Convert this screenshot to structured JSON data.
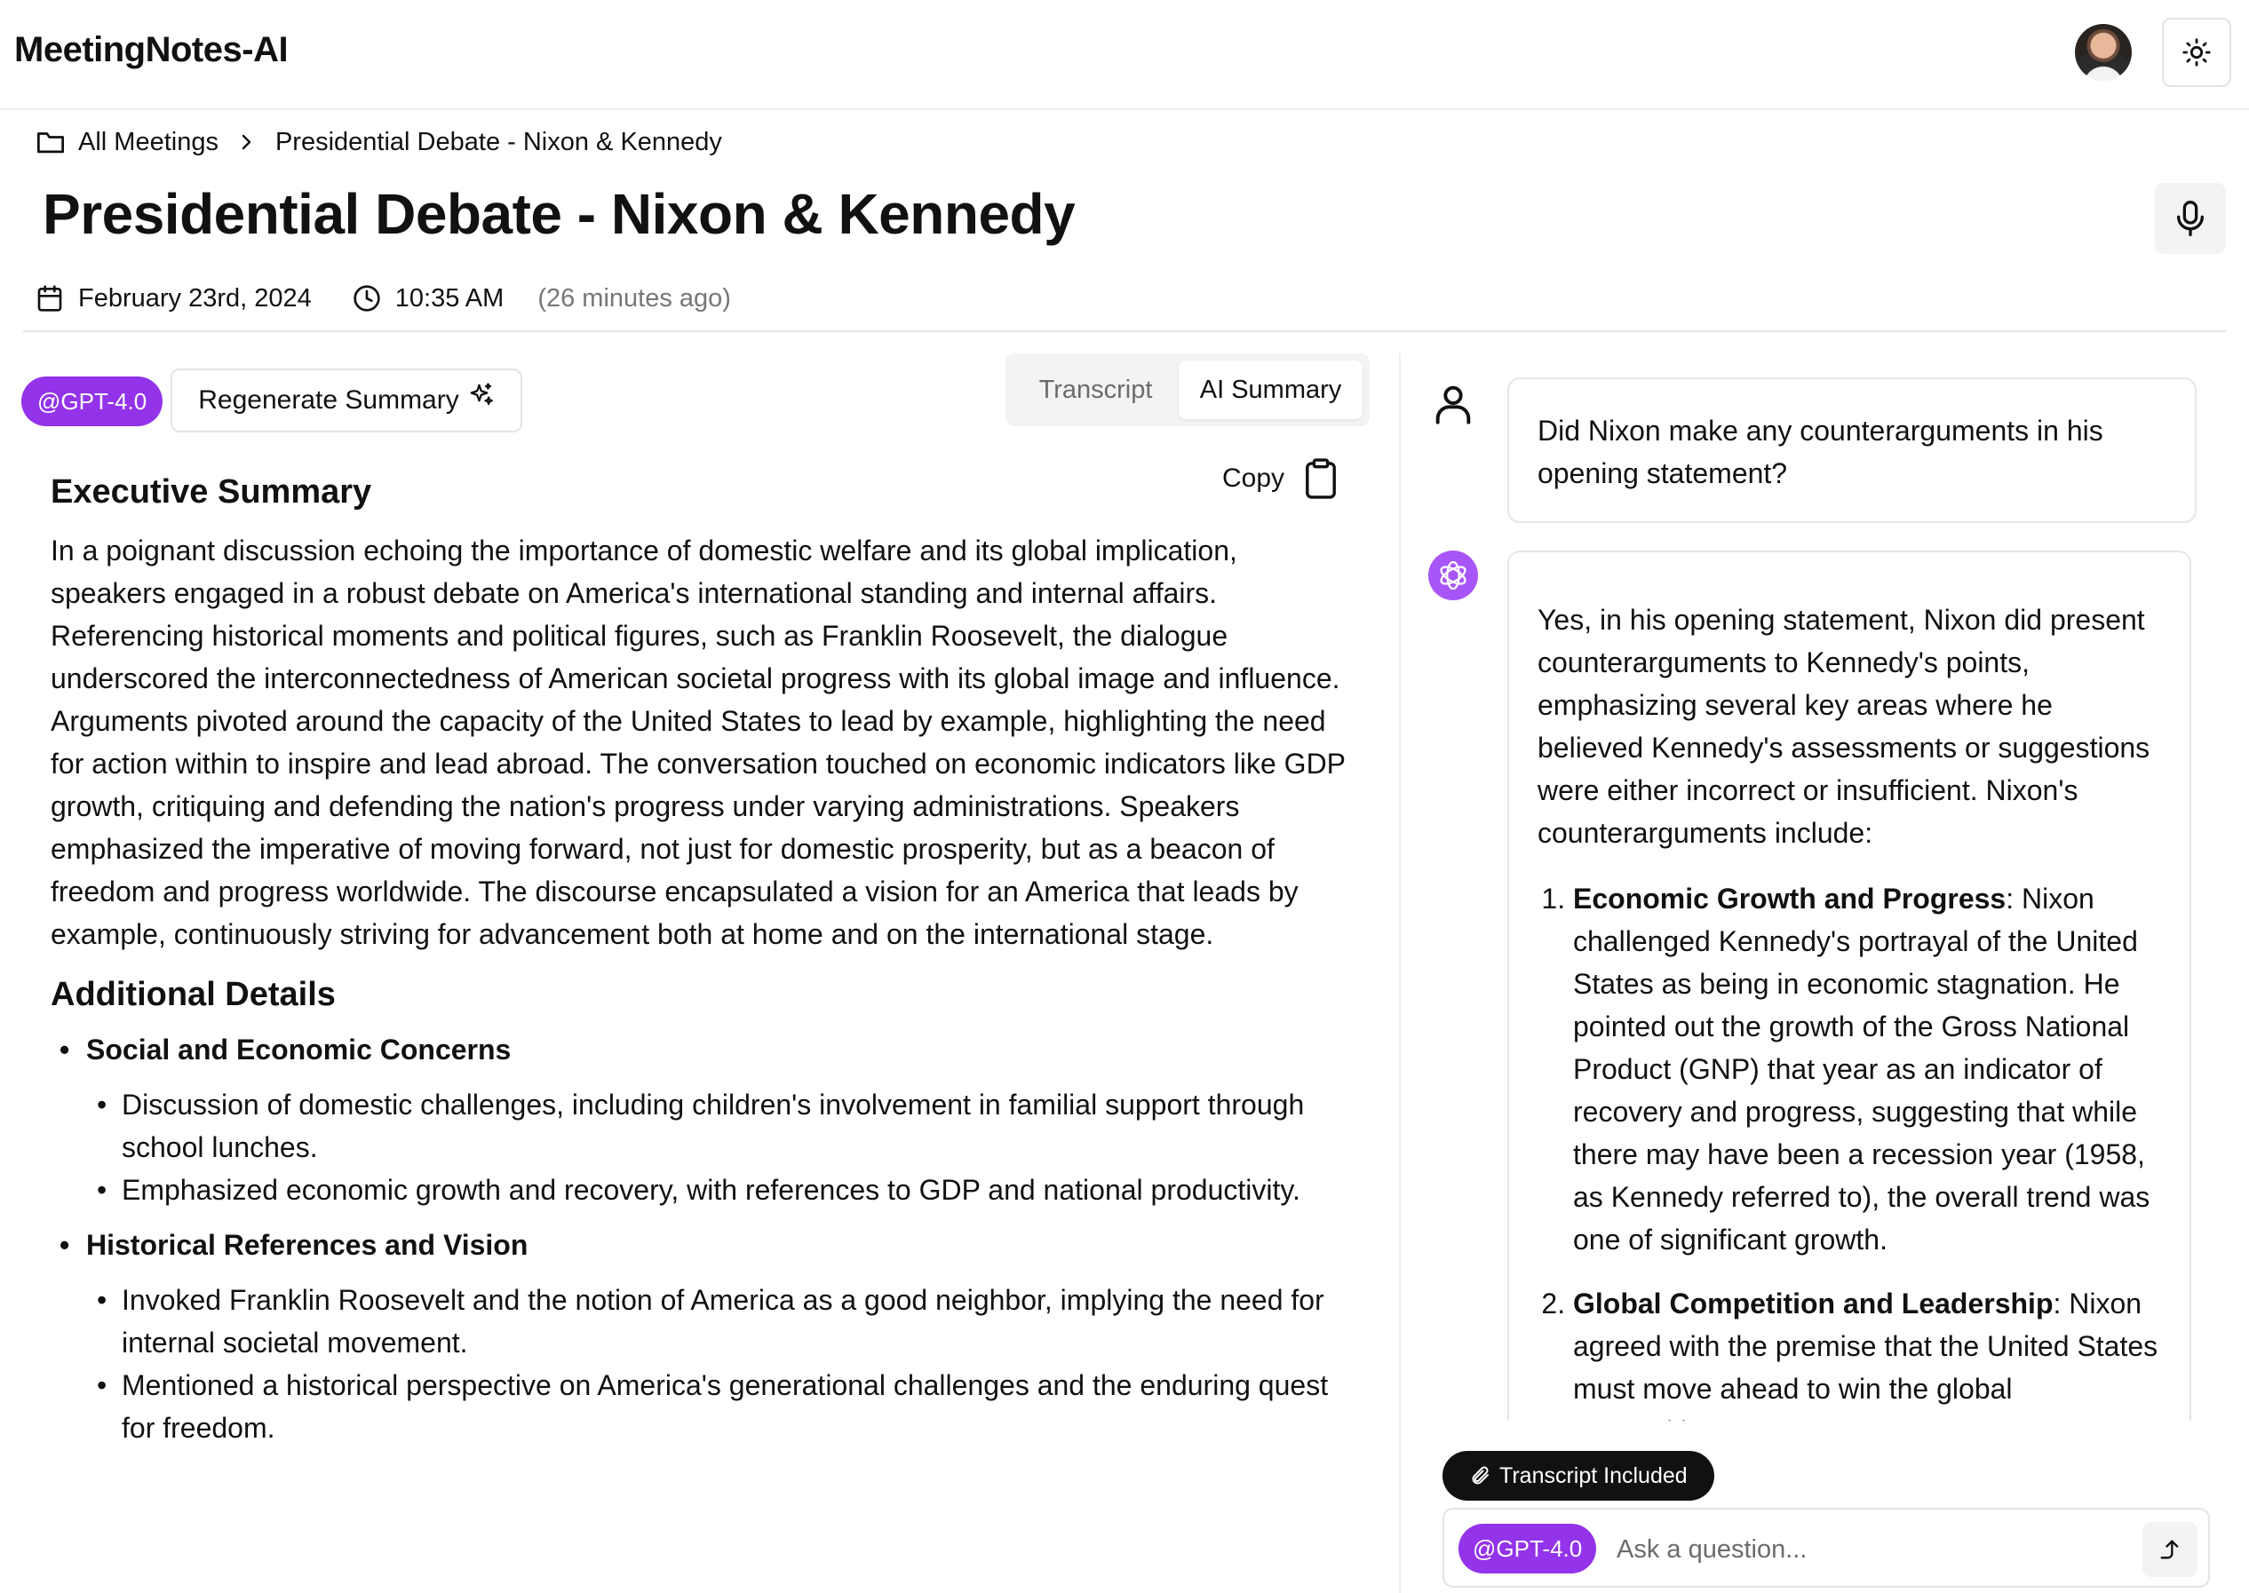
{
  "app": {
    "title": "MeetingNotes-AI"
  },
  "icons": {
    "avatar": "user-avatar",
    "theme": "sun-icon",
    "breadcrumb": "folder-icon",
    "separator": "chevron-right-icon",
    "record": "microphone-icon",
    "date": "calendar-icon",
    "time": "clock-icon",
    "regenerate": "sparkles-icon",
    "copy": "clipboard-icon",
    "user_message": "user-icon",
    "ai_message": "openai-icon",
    "attachment": "paperclip-icon",
    "send": "send-icon"
  },
  "colors": {
    "accent": "#9333ea",
    "ai_avatar": "#a855f7",
    "pill_dark": "#111111"
  },
  "breadcrumb": {
    "root": "All Meetings",
    "current": "Presidential Debate - Nixon & Kennedy"
  },
  "meeting": {
    "title": "Presidential Debate - Nixon & Kennedy",
    "date": "February 23rd, 2024",
    "time": "10:35 AM",
    "relative": "(26 minutes ago)"
  },
  "toolbar": {
    "model_badge": "@GPT-4.0",
    "regenerate_label": "Regenerate Summary"
  },
  "tabs": [
    {
      "label": "Transcript",
      "active": false
    },
    {
      "label": "AI Summary",
      "active": true
    }
  ],
  "summary": {
    "copy_label": "Copy",
    "executive_heading": "Executive Summary",
    "executive_text": "In a poignant discussion echoing the importance of domestic welfare and its global implication, speakers engaged in a robust debate on America's international standing and internal affairs. Referencing historical moments and political figures, such as Franklin Roosevelt, the dialogue underscored the interconnectedness of American societal progress with its global image and influence. Arguments pivoted around the capacity of the United States to lead by example, highlighting the need for action within to inspire and lead abroad. The conversation touched on economic indicators like GDP growth, critiquing and defending the nation's progress under varying administrations. Speakers emphasized the imperative of moving forward, not just for domestic prosperity, but as a beacon of freedom and progress worldwide. The discourse encapsulated a vision for an America that leads by example, continuously striving for advancement both at home and on the international stage.",
    "details_heading": "Additional Details",
    "details": [
      {
        "title": "Social and Economic Concerns",
        "items": [
          "Discussion of domestic challenges, including children's involvement in familial support through school lunches.",
          "Emphasized economic growth and recovery, with references to GDP and national productivity."
        ]
      },
      {
        "title": "Historical References and Vision",
        "items": [
          "Invoked Franklin Roosevelt and the notion of America as a good neighbor, implying the need for internal societal movement.",
          "Mentioned a historical perspective on America's generational challenges and the enduring quest for freedom."
        ]
      }
    ]
  },
  "chat": {
    "user_message": "Did Nixon make any counterarguments in his opening statement?",
    "ai_intro": "Yes, in his opening statement, Nixon did present counterarguments to Kennedy's points, emphasizing several key areas where he believed Kennedy's assessments or suggestions were either incorrect or insufficient. Nixon's counterarguments include:",
    "ai_points": [
      {
        "title": "Economic Growth and Progress",
        "text": ": Nixon challenged Kennedy's portrayal of the United States as being in economic stagnation. He pointed out the growth of the Gross National Product (GNP) that year as an indicator of recovery and progress, suggesting that while there may have been a recession year (1958, as Kennedy referred to), the overall trend was one of significant growth."
      },
      {
        "title": "Global Competition and Leadership",
        "text": ": Nixon agreed with the premise that the United States must move ahead to win the global competition."
      }
    ],
    "transcript_pill": "Transcript Included",
    "model_badge": "@GPT-4.0",
    "ask_placeholder": "Ask a question..."
  }
}
